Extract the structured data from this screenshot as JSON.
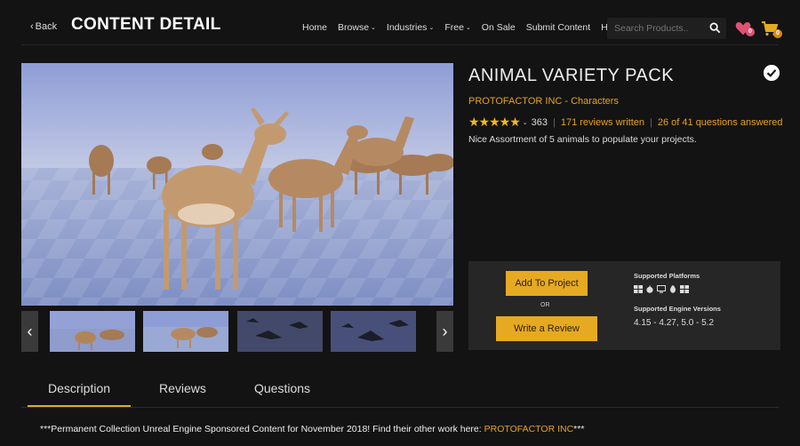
{
  "header": {
    "back_label": "Back",
    "title": "CONTENT DETAIL",
    "nav": [
      {
        "label": "Home",
        "chevron": false
      },
      {
        "label": "Browse",
        "chevron": true
      },
      {
        "label": "Industries",
        "chevron": true
      },
      {
        "label": "Free",
        "chevron": true
      },
      {
        "label": "On Sale",
        "chevron": false
      },
      {
        "label": "Submit Content",
        "chevron": false
      },
      {
        "label": "Help",
        "chevron": false
      }
    ],
    "search_placeholder": "Search Products..",
    "wishlist_count": "0",
    "cart_count": "0"
  },
  "product": {
    "title": "ANIMAL VARIETY PACK",
    "seller": "PROTOFACTOR INC - Characters",
    "stars": "★★★★★",
    "rating_count": "363",
    "reviews_link": "171 reviews written",
    "questions_link": "26 of 41 questions answered",
    "short_description": "Nice Assortment of 5 animals to populate your projects."
  },
  "actions": {
    "add_label": "Add To Project",
    "or_label": "OR",
    "review_label": "Write a Review",
    "platforms_label": "Supported Platforms",
    "platform_icons": [
      "windows-icon",
      "apple-icon",
      "monitor-icon",
      "linux-icon",
      "windows-icon"
    ],
    "engine_label": "Supported Engine Versions",
    "engine_versions": "4.15 - 4.27, 5.0 - 5.2"
  },
  "tabs": {
    "description": "Description",
    "reviews": "Reviews",
    "questions": "Questions"
  },
  "footer": {
    "note_prefix": "***Permanent Collection Unreal Engine Sponsored Content for November 2018! Find their other work here: ",
    "note_link": "PROTOFACTOR INC",
    "note_suffix": "***"
  },
  "colors": {
    "accent": "#e6a922",
    "background": "#131313",
    "panel": "#262626",
    "wishlist_badge": "#e05273"
  }
}
